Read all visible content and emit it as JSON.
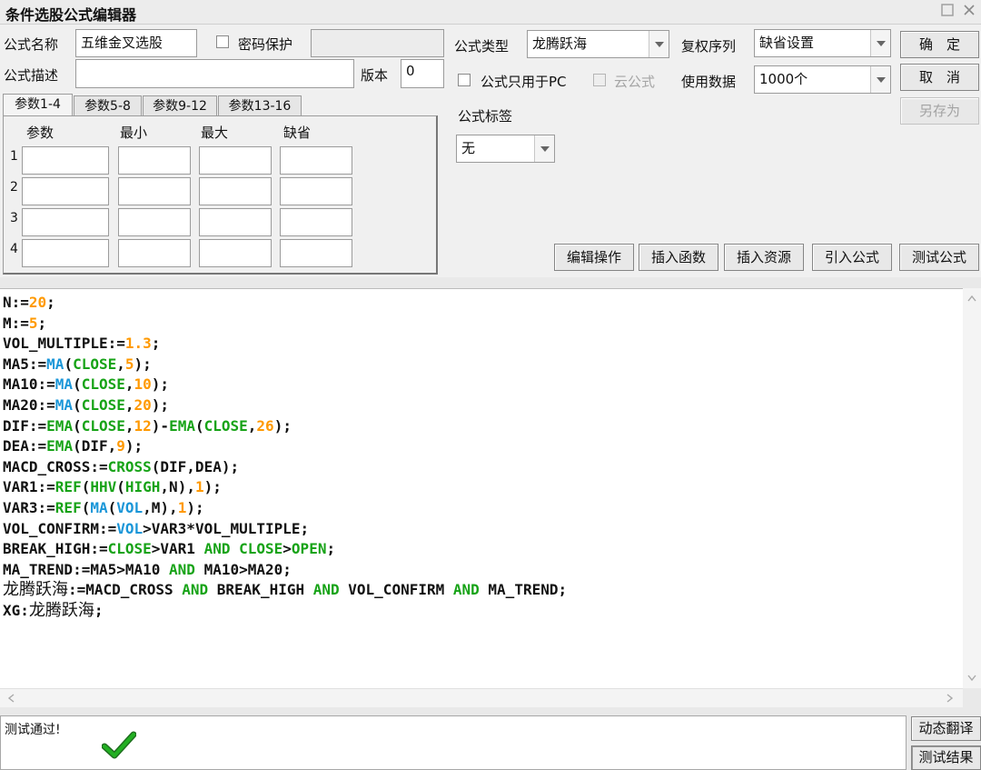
{
  "window": {
    "title": "条件选股公式编辑器"
  },
  "form": {
    "name_label": "公式名称",
    "name_value": "五维金叉选股",
    "password_label": "密码保护",
    "password_checked": false,
    "password_value": "",
    "desc_label": "公式描述",
    "desc_value": "",
    "version_label": "版本",
    "version_value": "0",
    "type_label": "公式类型",
    "type_value": "龙腾跃海",
    "pc_only_label": "公式只用于PC",
    "cloud_label": "云公式",
    "fq_label": "复权序列",
    "fq_value": "缺省设置",
    "data_label": "使用数据",
    "data_value": "1000个",
    "tag_label": "公式标签",
    "tag_value": "无"
  },
  "buttons": {
    "ok": "确　定",
    "cancel": "取　消",
    "save_as": "另存为",
    "edit_ops": "编辑操作",
    "insert_func": "插入函数",
    "insert_resource": "插入资源",
    "import_formula": "引入公式",
    "test_formula": "测试公式",
    "dynamic_translate": "动态翻译",
    "test_result": "测试结果"
  },
  "param_tabs": [
    "参数1-4",
    "参数5-8",
    "参数9-12",
    "参数13-16"
  ],
  "param_headers": [
    "参数",
    "最小",
    "最大",
    "缺省"
  ],
  "param_rows": [
    "1",
    "2",
    "3",
    "4"
  ],
  "code_lines": [
    [
      [
        "N:=",
        "d"
      ],
      [
        "20",
        "n"
      ],
      [
        ";",
        "d"
      ]
    ],
    [
      [
        "M:=",
        "d"
      ],
      [
        "5",
        "n"
      ],
      [
        ";",
        "d"
      ]
    ],
    [
      [
        "VOL_MULTIPLE:=",
        "d"
      ],
      [
        "1.3",
        "n"
      ],
      [
        ";",
        "d"
      ]
    ],
    [
      [
        "MA5:=",
        "d"
      ],
      [
        "MA",
        "f"
      ],
      [
        "(",
        "d"
      ],
      [
        "CLOSE",
        "k"
      ],
      [
        ",",
        "d"
      ],
      [
        "5",
        "n"
      ],
      [
        ");",
        "d"
      ]
    ],
    [
      [
        "MA10:=",
        "d"
      ],
      [
        "MA",
        "f"
      ],
      [
        "(",
        "d"
      ],
      [
        "CLOSE",
        "k"
      ],
      [
        ",",
        "d"
      ],
      [
        "10",
        "n"
      ],
      [
        ");",
        "d"
      ]
    ],
    [
      [
        "MA20:=",
        "d"
      ],
      [
        "MA",
        "f"
      ],
      [
        "(",
        "d"
      ],
      [
        "CLOSE",
        "k"
      ],
      [
        ",",
        "d"
      ],
      [
        "20",
        "n"
      ],
      [
        ");",
        "d"
      ]
    ],
    [
      [
        "DIF:=",
        "d"
      ],
      [
        "EMA",
        "k"
      ],
      [
        "(",
        "d"
      ],
      [
        "CLOSE",
        "k"
      ],
      [
        ",",
        "d"
      ],
      [
        "12",
        "n"
      ],
      [
        ")-",
        "d"
      ],
      [
        "EMA",
        "k"
      ],
      [
        "(",
        "d"
      ],
      [
        "CLOSE",
        "k"
      ],
      [
        ",",
        "d"
      ],
      [
        "26",
        "n"
      ],
      [
        ");",
        "d"
      ]
    ],
    [
      [
        "DEA:=",
        "d"
      ],
      [
        "EMA",
        "k"
      ],
      [
        "(DIF,",
        "d"
      ],
      [
        "9",
        "n"
      ],
      [
        ");",
        "d"
      ]
    ],
    [
      [
        "MACD_CROSS:=",
        "d"
      ],
      [
        "CROSS",
        "k"
      ],
      [
        "(DIF,DEA);",
        "d"
      ]
    ],
    [
      [
        "VAR1:=",
        "d"
      ],
      [
        "REF",
        "k"
      ],
      [
        "(",
        "d"
      ],
      [
        "HHV",
        "k"
      ],
      [
        "(",
        "d"
      ],
      [
        "HIGH",
        "k"
      ],
      [
        ",N),",
        "d"
      ],
      [
        "1",
        "n"
      ],
      [
        ");",
        "d"
      ]
    ],
    [
      [
        "VAR3:=",
        "d"
      ],
      [
        "REF",
        "k"
      ],
      [
        "(",
        "d"
      ],
      [
        "MA",
        "f"
      ],
      [
        "(",
        "d"
      ],
      [
        "VOL",
        "f"
      ],
      [
        ",M),",
        "d"
      ],
      [
        "1",
        "n"
      ],
      [
        ");",
        "d"
      ]
    ],
    [
      [
        "VOL_CONFIRM:=",
        "d"
      ],
      [
        "VOL",
        "f"
      ],
      [
        ">VAR3*VOL_MULTIPLE;",
        "d"
      ]
    ],
    [
      [
        "BREAK_HIGH:=",
        "d"
      ],
      [
        "CLOSE",
        "k"
      ],
      [
        ">VAR1 ",
        "d"
      ],
      [
        "AND",
        "k"
      ],
      [
        " ",
        "d"
      ],
      [
        "CLOSE",
        "k"
      ],
      [
        ">",
        "d"
      ],
      [
        "OPEN",
        "k"
      ],
      [
        ";",
        "d"
      ]
    ],
    [
      [
        "MA_TREND:=MA5>MA10 ",
        "d"
      ],
      [
        "AND",
        "k"
      ],
      [
        " MA10>MA20;",
        "d"
      ]
    ],
    [
      [
        "龙腾跃海",
        "c"
      ],
      [
        ":=MACD_CROSS ",
        "d"
      ],
      [
        "AND",
        "k"
      ],
      [
        " BREAK_HIGH ",
        "d"
      ],
      [
        "AND",
        "k"
      ],
      [
        " VOL_CONFIRM ",
        "d"
      ],
      [
        "AND",
        "k"
      ],
      [
        " MA_TREND;",
        "d"
      ]
    ],
    [
      [
        "XG:",
        "d"
      ],
      [
        "龙腾跃海",
        "c"
      ],
      [
        ";",
        "d"
      ]
    ]
  ],
  "status": {
    "message": "测试通过!"
  },
  "icons": {
    "check": "check-icon",
    "close": "close-icon",
    "restore": "restore-icon"
  },
  "colors": {
    "number": "#ff9900",
    "function": "#1a96d8",
    "keyword": "#17a317",
    "check": "#1fa31f"
  }
}
